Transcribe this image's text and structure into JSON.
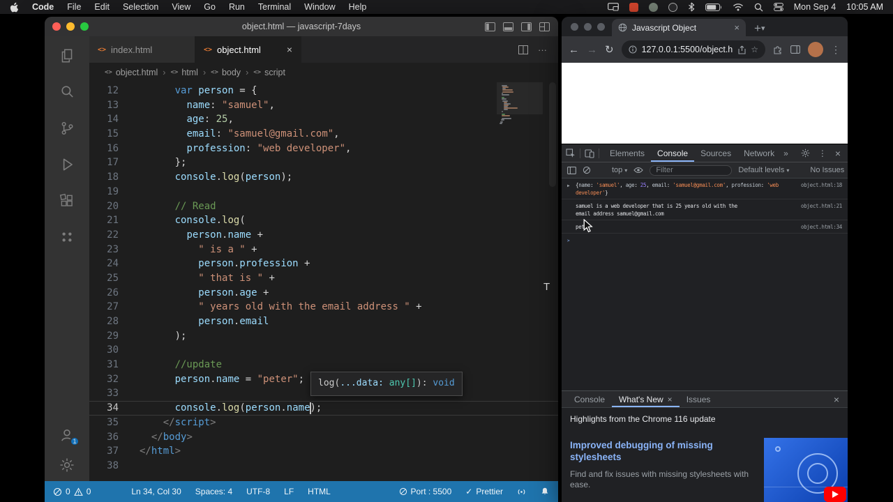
{
  "menubar": {
    "menus": [
      "Code",
      "File",
      "Edit",
      "Selection",
      "View",
      "Go",
      "Run",
      "Terminal",
      "Window",
      "Help"
    ],
    "date": "Mon Sep 4",
    "time": "10:05 AM"
  },
  "vscode": {
    "title": "object.html — javascript-7days",
    "tabs": [
      {
        "label": "index.html",
        "active": false
      },
      {
        "label": "object.html",
        "active": true
      }
    ],
    "breadcrumb": [
      "object.html",
      "html",
      "body",
      "script"
    ],
    "code_lines": [
      {
        "n": 12,
        "t": [
          [
            "      ",
            "p"
          ],
          [
            "var ",
            "k"
          ],
          [
            "person",
            "v"
          ],
          [
            " = {",
            "p"
          ]
        ]
      },
      {
        "n": 13,
        "t": [
          [
            "        ",
            "p"
          ],
          [
            "name",
            "v"
          ],
          [
            ": ",
            "p"
          ],
          [
            "\"samuel\"",
            "s"
          ],
          [
            ",",
            "p"
          ]
        ]
      },
      {
        "n": 14,
        "t": [
          [
            "        ",
            "p"
          ],
          [
            "age",
            "v"
          ],
          [
            ": ",
            "p"
          ],
          [
            "25",
            "n"
          ],
          [
            ",",
            "p"
          ]
        ]
      },
      {
        "n": 15,
        "t": [
          [
            "        ",
            "p"
          ],
          [
            "email",
            "v"
          ],
          [
            ": ",
            "p"
          ],
          [
            "\"samuel@gmail.com\"",
            "s"
          ],
          [
            ",",
            "p"
          ]
        ]
      },
      {
        "n": 16,
        "t": [
          [
            "        ",
            "p"
          ],
          [
            "profession",
            "v"
          ],
          [
            ": ",
            "p"
          ],
          [
            "\"web developer\"",
            "s"
          ],
          [
            ",",
            "p"
          ]
        ]
      },
      {
        "n": 17,
        "t": [
          [
            "      ",
            "p"
          ],
          [
            "};",
            "p"
          ]
        ]
      },
      {
        "n": 18,
        "t": [
          [
            "      ",
            "p"
          ],
          [
            "console",
            "v"
          ],
          [
            ".",
            "p"
          ],
          [
            "log",
            "f"
          ],
          [
            "(",
            "p"
          ],
          [
            "person",
            "v"
          ],
          [
            ");",
            "p"
          ]
        ]
      },
      {
        "n": 19,
        "t": []
      },
      {
        "n": 20,
        "t": [
          [
            "      ",
            "p"
          ],
          [
            "// Read",
            "c"
          ]
        ]
      },
      {
        "n": 21,
        "t": [
          [
            "      ",
            "p"
          ],
          [
            "console",
            "v"
          ],
          [
            ".",
            "p"
          ],
          [
            "log",
            "f"
          ],
          [
            "(",
            "p"
          ]
        ]
      },
      {
        "n": 22,
        "t": [
          [
            "        ",
            "p"
          ],
          [
            "person",
            "v"
          ],
          [
            ".",
            "p"
          ],
          [
            "name",
            "v"
          ],
          [
            " +",
            "p"
          ]
        ]
      },
      {
        "n": 23,
        "t": [
          [
            "          ",
            "p"
          ],
          [
            "\" is a \"",
            "s"
          ],
          [
            " +",
            "p"
          ]
        ]
      },
      {
        "n": 24,
        "t": [
          [
            "          ",
            "p"
          ],
          [
            "person",
            "v"
          ],
          [
            ".",
            "p"
          ],
          [
            "profession",
            "v"
          ],
          [
            " +",
            "p"
          ]
        ]
      },
      {
        "n": 25,
        "t": [
          [
            "          ",
            "p"
          ],
          [
            "\" that is \"",
            "s"
          ],
          [
            " +",
            "p"
          ]
        ]
      },
      {
        "n": 26,
        "t": [
          [
            "          ",
            "p"
          ],
          [
            "person",
            "v"
          ],
          [
            ".",
            "p"
          ],
          [
            "age",
            "v"
          ],
          [
            " +",
            "p"
          ]
        ]
      },
      {
        "n": 27,
        "t": [
          [
            "          ",
            "p"
          ],
          [
            "\" years old with the email address \"",
            "s"
          ],
          [
            " +",
            "p"
          ]
        ]
      },
      {
        "n": 28,
        "t": [
          [
            "          ",
            "p"
          ],
          [
            "person",
            "v"
          ],
          [
            ".",
            "p"
          ],
          [
            "email",
            "v"
          ]
        ]
      },
      {
        "n": 29,
        "t": [
          [
            "      ",
            "p"
          ],
          [
            ");",
            "p"
          ]
        ]
      },
      {
        "n": 30,
        "t": []
      },
      {
        "n": 31,
        "t": [
          [
            "      ",
            "p"
          ],
          [
            "//update",
            "c"
          ]
        ]
      },
      {
        "n": 32,
        "t": [
          [
            "      ",
            "p"
          ],
          [
            "person",
            "v"
          ],
          [
            ".",
            "p"
          ],
          [
            "name",
            "v"
          ],
          [
            " = ",
            "p"
          ],
          [
            "\"peter\"",
            "s"
          ],
          [
            ";",
            "p"
          ]
        ]
      },
      {
        "n": 33,
        "t": []
      },
      {
        "n": 34,
        "t": [
          [
            "      ",
            "p"
          ],
          [
            "console",
            "v"
          ],
          [
            ".",
            "p"
          ],
          [
            "log",
            "f"
          ],
          [
            "(",
            "p"
          ],
          [
            "person",
            "v"
          ],
          [
            ".",
            "p"
          ],
          [
            "name",
            "v"
          ],
          [
            ");",
            "p"
          ]
        ]
      },
      {
        "n": 35,
        "t": [
          [
            "    ",
            "p"
          ],
          [
            "</",
            "g"
          ],
          [
            "script",
            "k"
          ],
          [
            ">",
            "g"
          ]
        ]
      },
      {
        "n": 36,
        "t": [
          [
            "  ",
            "p"
          ],
          [
            "</",
            "g"
          ],
          [
            "body",
            "k"
          ],
          [
            ">",
            "g"
          ]
        ]
      },
      {
        "n": 37,
        "t": [
          [
            "</",
            "g"
          ],
          [
            "html",
            "k"
          ],
          [
            ">",
            "g"
          ]
        ]
      },
      {
        "n": 38,
        "t": []
      }
    ],
    "tooltip": [
      [
        "log(",
        "w"
      ],
      [
        "...data:",
        "pm"
      ],
      [
        " ",
        "w"
      ],
      [
        "any[]",
        "ty"
      ],
      [
        "): ",
        "w"
      ],
      [
        "void",
        "kw"
      ]
    ],
    "stray_character": "T",
    "status": {
      "errors": "0",
      "warnings": "0",
      "ln": "Ln 34, Col 30",
      "spaces": "Spaces: 4",
      "enc": "UTF-8",
      "eol": "LF",
      "lang": "HTML",
      "port": "Port : 5500",
      "fmt": "Prettier"
    }
  },
  "chrome": {
    "tab_title": "Javascript Object",
    "url": "127.0.0.1:5500/object.h...",
    "devtools": {
      "tabs": [
        "Elements",
        "Console",
        "Sources",
        "Network"
      ],
      "active_tab": "Console",
      "more_tabs": "»",
      "context": "top",
      "filter_placeholder": "Filter",
      "levels": "Default levels",
      "issues": "No Issues",
      "console_rows": [
        {
          "expand": true,
          "link": "object.html:18",
          "lines": [
            [
              [
                "{",
                "pl"
              ],
              [
                "name",
                "key"
              ],
              [
                ": ",
                "pl"
              ],
              [
                "'samuel'",
                "str"
              ],
              [
                ", ",
                "pl"
              ],
              [
                "age",
                "key"
              ],
              [
                ": ",
                "pl"
              ],
              [
                "25",
                "num"
              ],
              [
                ", ",
                "pl"
              ],
              [
                "email",
                "key"
              ],
              [
                ": ",
                "pl"
              ],
              [
                "'samuel@gmail.com'",
                "str"
              ],
              [
                ", ",
                "pl"
              ],
              [
                "profession",
                "key"
              ],
              [
                ": ",
                "pl"
              ],
              [
                "'web",
                "str"
              ]
            ],
            [
              [
                "developer'",
                "str"
              ],
              [
                "}",
                "pl"
              ]
            ]
          ]
        },
        {
          "link": "object.html:21",
          "lines": [
            [
              [
                "samuel is a web developer that is 25 years old with the",
                "pl"
              ]
            ],
            [
              [
                "email address samuel@gmail.com",
                "pl"
              ]
            ]
          ]
        },
        {
          "link": "object.html:34",
          "lines": [
            [
              [
                "peter",
                "pl"
              ]
            ]
          ]
        }
      ],
      "prompt": ">"
    },
    "drawer": {
      "tabs": [
        {
          "label": "Console",
          "active": false,
          "closable": false
        },
        {
          "label": "What's New",
          "active": true,
          "closable": true
        },
        {
          "label": "Issues",
          "active": false,
          "closable": false
        }
      ],
      "heading": "Highlights from the Chrome 116 update",
      "card_title": "Improved debugging of missing stylesheets",
      "card_body": "Find and fix issues with missing stylesheets with ease."
    }
  }
}
